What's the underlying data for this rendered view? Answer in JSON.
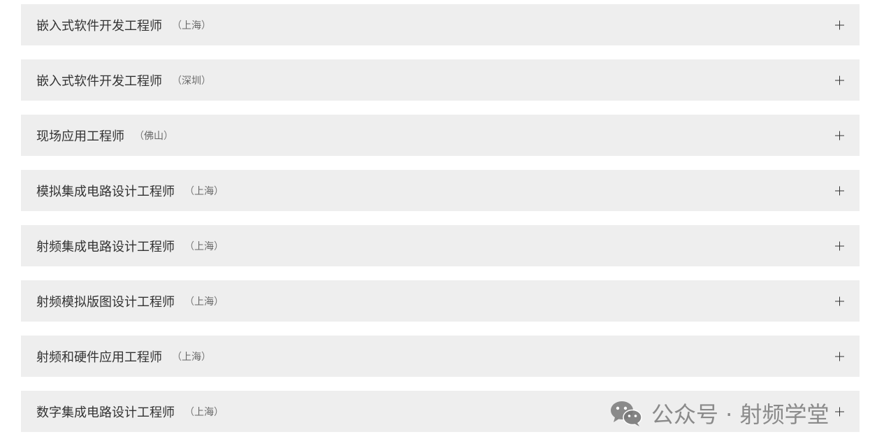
{
  "jobs": [
    {
      "title": "嵌入式软件开发工程师",
      "location": "上海"
    },
    {
      "title": "嵌入式软件开发工程师",
      "location": "深圳"
    },
    {
      "title": "现场应用工程师",
      "location": "佛山"
    },
    {
      "title": "模拟集成电路设计工程师",
      "location": "上海"
    },
    {
      "title": "射频集成电路设计工程师",
      "location": "上海"
    },
    {
      "title": "射频模拟版图设计工程师",
      "location": "上海"
    },
    {
      "title": "射频和硬件应用工程师",
      "location": "上海"
    },
    {
      "title": "数字集成电路设计工程师",
      "location": "上海"
    }
  ],
  "paren_open": "（",
  "paren_close": "）",
  "watermark": {
    "text": "公众号 · 射频学堂",
    "icon": "wechat-icon"
  },
  "colors": {
    "row_background": "#eeeeee",
    "title_text": "#333333",
    "location_text": "#666666"
  }
}
